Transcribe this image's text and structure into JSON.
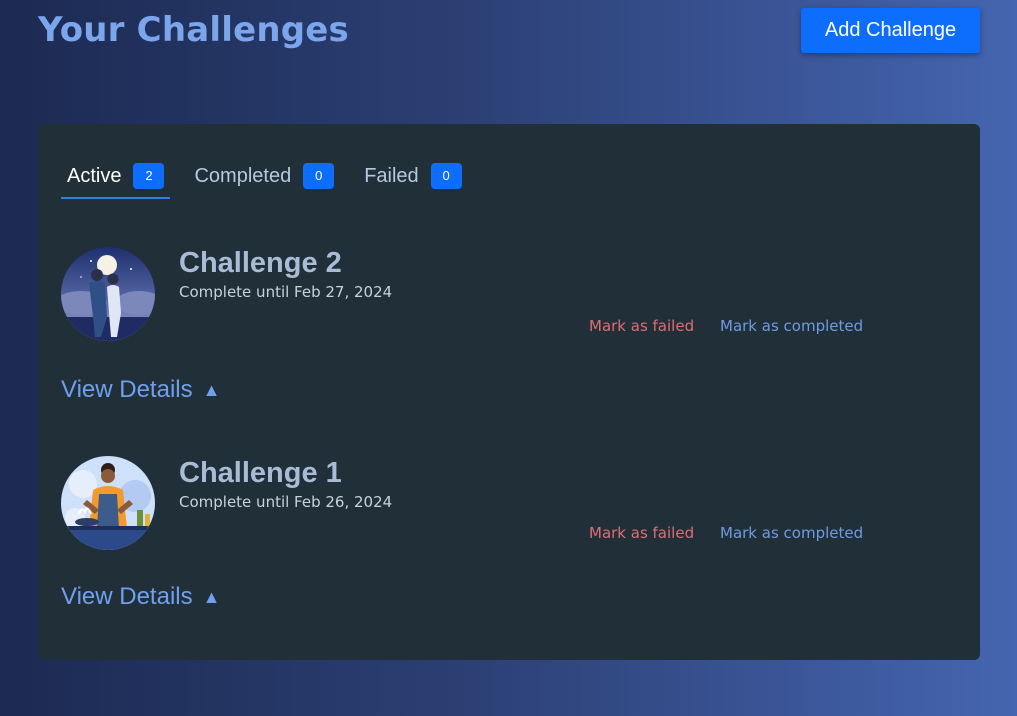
{
  "header": {
    "title": "Your Challenges",
    "add_button_label": "Add Challenge"
  },
  "tabs": [
    {
      "label": "Active",
      "count": "2",
      "active": true
    },
    {
      "label": "Completed",
      "count": "0",
      "active": false
    },
    {
      "label": "Failed",
      "count": "0",
      "active": false
    }
  ],
  "challenges": [
    {
      "title": "Challenge 2",
      "subtitle": "Complete until Feb 27, 2024",
      "fail_label": "Mark as failed",
      "complete_label": "Mark as completed",
      "details_label": "View Details",
      "details_caret": "▲",
      "image": "couple-under-moon-illustration"
    },
    {
      "title": "Challenge 1",
      "subtitle": "Complete until Feb 26, 2024",
      "fail_label": "Mark as failed",
      "complete_label": "Mark as completed",
      "details_label": "View Details",
      "details_caret": "▲",
      "image": "man-cooking-illustration"
    }
  ],
  "colors": {
    "accent": "#0d6efd",
    "title": "#7ba6ec",
    "card_bg": "#212f38",
    "failed": "#e06c75",
    "completed": "#6f9be0"
  }
}
